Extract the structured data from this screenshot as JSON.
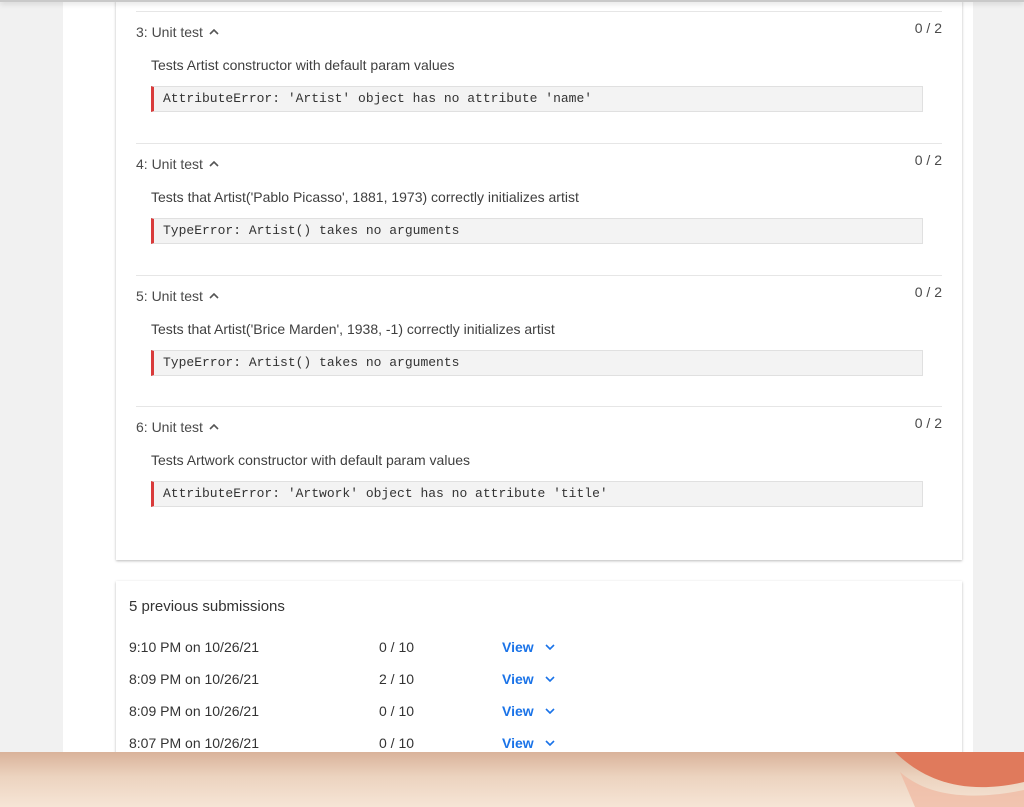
{
  "tests": [
    {
      "header": "3: Unit test",
      "score": "0 / 2",
      "description": "Tests Artist constructor with default param values",
      "error": "AttributeError: 'Artist' object has no attribute 'name'"
    },
    {
      "header": "4: Unit test",
      "score": "0 / 2",
      "description": "Tests that Artist('Pablo Picasso', 1881, 1973) correctly initializes artist",
      "error": "TypeError: Artist() takes no arguments"
    },
    {
      "header": "5: Unit test",
      "score": "0 / 2",
      "description": "Tests that Artist('Brice Marden', 1938, -1) correctly initializes artist",
      "error": "TypeError: Artist() takes no arguments"
    },
    {
      "header": "6: Unit test",
      "score": "0 / 2",
      "description": "Tests Artwork constructor with default param values",
      "error": "AttributeError: 'Artwork' object has no attribute 'title'"
    }
  ],
  "submissions": {
    "title": "5 previous submissions",
    "rows": [
      {
        "time": "9:10 PM on 10/26/21",
        "score": "0 / 10",
        "view": "View"
      },
      {
        "time": "8:09 PM on 10/26/21",
        "score": "2 / 10",
        "view": "View"
      },
      {
        "time": "8:09 PM on 10/26/21",
        "score": "0 / 10",
        "view": "View"
      },
      {
        "time": "8:07 PM on 10/26/21",
        "score": "0 / 10",
        "view": "View"
      }
    ]
  },
  "icons": {
    "expanded": "chevron-up-icon",
    "collapsed": "chevron-down-icon"
  },
  "colors": {
    "error_accent": "#d93b3b",
    "link": "#1a73e8"
  }
}
